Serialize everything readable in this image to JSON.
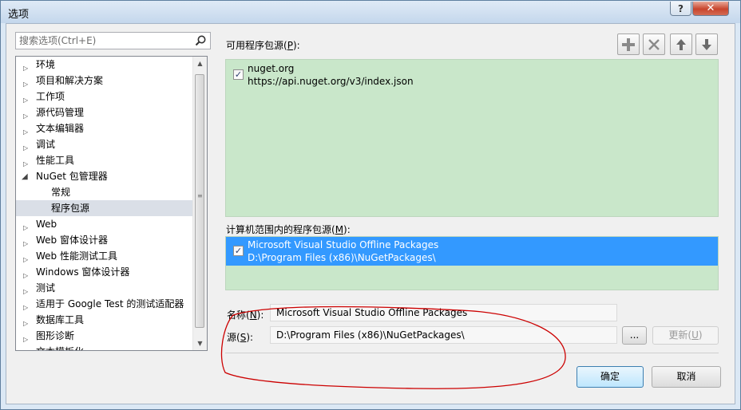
{
  "window": {
    "title": "选项",
    "help_label": "?",
    "close_label": "✕"
  },
  "search": {
    "placeholder": "搜索选项(Ctrl+E)",
    "icon": "search-icon"
  },
  "tree": {
    "items": [
      {
        "label": "环境",
        "expanded": false
      },
      {
        "label": "项目和解决方案",
        "expanded": false
      },
      {
        "label": "工作项",
        "expanded": false
      },
      {
        "label": "源代码管理",
        "expanded": false
      },
      {
        "label": "文本编辑器",
        "expanded": false
      },
      {
        "label": "调试",
        "expanded": false
      },
      {
        "label": "性能工具",
        "expanded": false
      },
      {
        "label": "NuGet 包管理器",
        "expanded": true
      },
      {
        "label": "常规",
        "child": true
      },
      {
        "label": "程序包源",
        "child": true,
        "selected": true
      },
      {
        "label": "Web",
        "expanded": false
      },
      {
        "label": "Web 窗体设计器",
        "expanded": false
      },
      {
        "label": "Web 性能测试工具",
        "expanded": false
      },
      {
        "label": "Windows 窗体设计器",
        "expanded": false
      },
      {
        "label": "测试",
        "expanded": false
      },
      {
        "label": "适用于 Google Test 的测试适配器",
        "expanded": false
      },
      {
        "label": "数据库工具",
        "expanded": false
      },
      {
        "label": "图形诊断",
        "expanded": false
      },
      {
        "label": "文本模板化",
        "expanded": false
      }
    ]
  },
  "available": {
    "label_prefix": "可用程序包源(",
    "label_key": "P",
    "label_suffix": "):",
    "sources": [
      {
        "name": "nuget.org",
        "url": "https://api.nuget.org/v3/index.json",
        "checked": true
      }
    ]
  },
  "machine": {
    "label_prefix": "计算机范围内的程序包源(",
    "label_key": "M",
    "label_suffix": "):",
    "sources": [
      {
        "name": "Microsoft Visual Studio Offline Packages",
        "url": "D:\\Program Files (x86)\\NuGetPackages\\",
        "checked": true,
        "selected": true
      }
    ]
  },
  "form": {
    "name_prefix": "名称(",
    "name_key": "N",
    "name_suffix": "):",
    "name_value": "Microsoft Visual Studio Offline Packages",
    "source_prefix": "源(",
    "source_key": "S",
    "source_suffix": "):",
    "source_value": "D:\\Program Files (x86)\\NuGetPackages\\",
    "browse_label": "...",
    "update_prefix": "更新(",
    "update_key": "U",
    "update_suffix": ")"
  },
  "buttons": {
    "ok": "确定",
    "cancel": "取消"
  },
  "colors": {
    "list_background": "#c9e7ca",
    "selection": "#3399ff",
    "annotation": "#cc0000"
  }
}
